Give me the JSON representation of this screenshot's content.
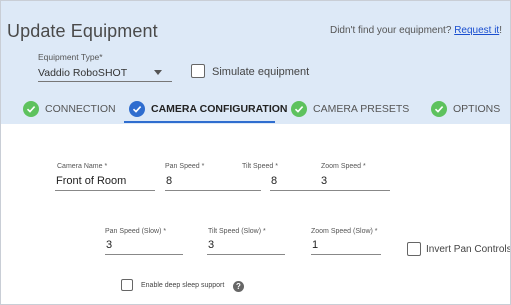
{
  "header": {
    "title": "Update Equipment",
    "request_prefix": "Didn't find your equipment? ",
    "request_link": "Request it",
    "request_suffix": "!"
  },
  "equipment": {
    "label": "Equipment Type*",
    "value": "Vaddio RoboSHOT"
  },
  "simulate": {
    "label": "Simulate equipment",
    "checked": false
  },
  "tabs": [
    {
      "label": "CONNECTION",
      "active": false,
      "color": "#5ec25e"
    },
    {
      "label": "CAMERA CONFIGURATION",
      "active": true,
      "color": "#2f6dcf"
    },
    {
      "label": "CAMERA PRESETS",
      "active": false,
      "color": "#5ec25e"
    },
    {
      "label": "OPTIONS",
      "active": false,
      "color": "#5ec25e"
    }
  ],
  "fields": {
    "camera_name": {
      "label": "Camera Name *",
      "value": "Front of Room"
    },
    "pan_speed": {
      "label": "Pan Speed *",
      "value": "8"
    },
    "tilt_speed": {
      "label": "Tilt Speed *",
      "value": "8"
    },
    "zoom_speed": {
      "label": "Zoom Speed *",
      "value": "3"
    },
    "pan_speed_slow": {
      "label": "Pan Speed  (Slow) *",
      "value": "3"
    },
    "tilt_speed_slow": {
      "label": "Tilt Speed  (Slow) *",
      "value": "3"
    },
    "zoom_speed_slow": {
      "label": "Zoom Speed  (Slow) *",
      "value": "1"
    }
  },
  "invert": {
    "label": "Invert Pan Controls",
    "checked": false
  },
  "deep_sleep": {
    "label": "Enable deep sleep support",
    "checked": false,
    "help_icon": "?"
  },
  "colors": {
    "header_bg": "#dde9f7",
    "accent": "#2f6dcf",
    "complete": "#5ec25e",
    "link": "#1a4fd0"
  }
}
